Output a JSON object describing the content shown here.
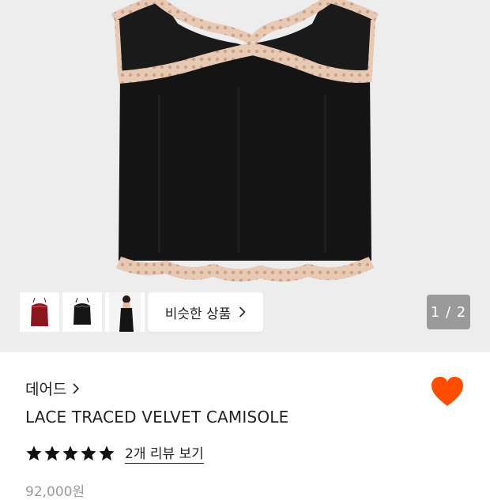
{
  "gallery": {
    "counter": "1 / 2",
    "similar_label": "비슷한 상품",
    "thumbnails": [
      {
        "name": "red camisole"
      },
      {
        "name": "black camisole"
      },
      {
        "name": "model wearing camisole"
      }
    ]
  },
  "product": {
    "brand": "데어드",
    "title": "LACE TRACED VELVET CAMISOLE",
    "rating_stars": 5,
    "review_link": "2개 리뷰 보기",
    "price": "92,000원"
  },
  "icons": [
    "chevron-right-icon",
    "heart-icon",
    "star-icon"
  ],
  "colors": {
    "accent_heart": "#ff4d00",
    "background_gallery": "#ededed",
    "counter_badge": "#9a9a9a"
  }
}
